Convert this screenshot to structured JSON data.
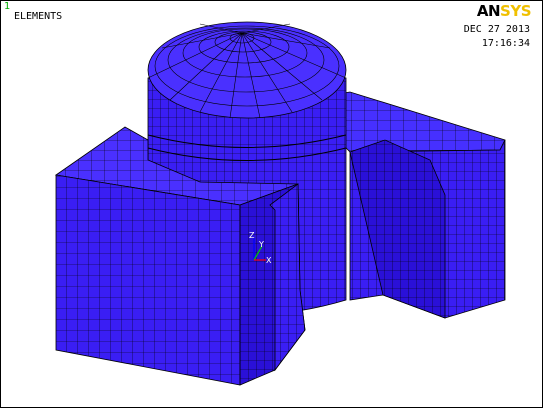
{
  "window_number": "1",
  "plot_title": "ELEMENTS",
  "date": "DEC 27 2013",
  "time": "17:16:34",
  "logo": {
    "part1": "AN",
    "part2": "SYS"
  },
  "triad": {
    "z": "Z",
    "y": "Y",
    "x": "X"
  },
  "colors": {
    "mesh_fill": "#3a1ef4",
    "mesh_fill_dark": "#2a10d8",
    "mesh_fill_light": "#4a30ff",
    "mesh_line": "#000000",
    "triad_x": "#ff0000",
    "triad_y": "#00cc00",
    "triad_z": "#0000ff",
    "logo_an": "#000000",
    "logo_sys": "#f0c000"
  }
}
